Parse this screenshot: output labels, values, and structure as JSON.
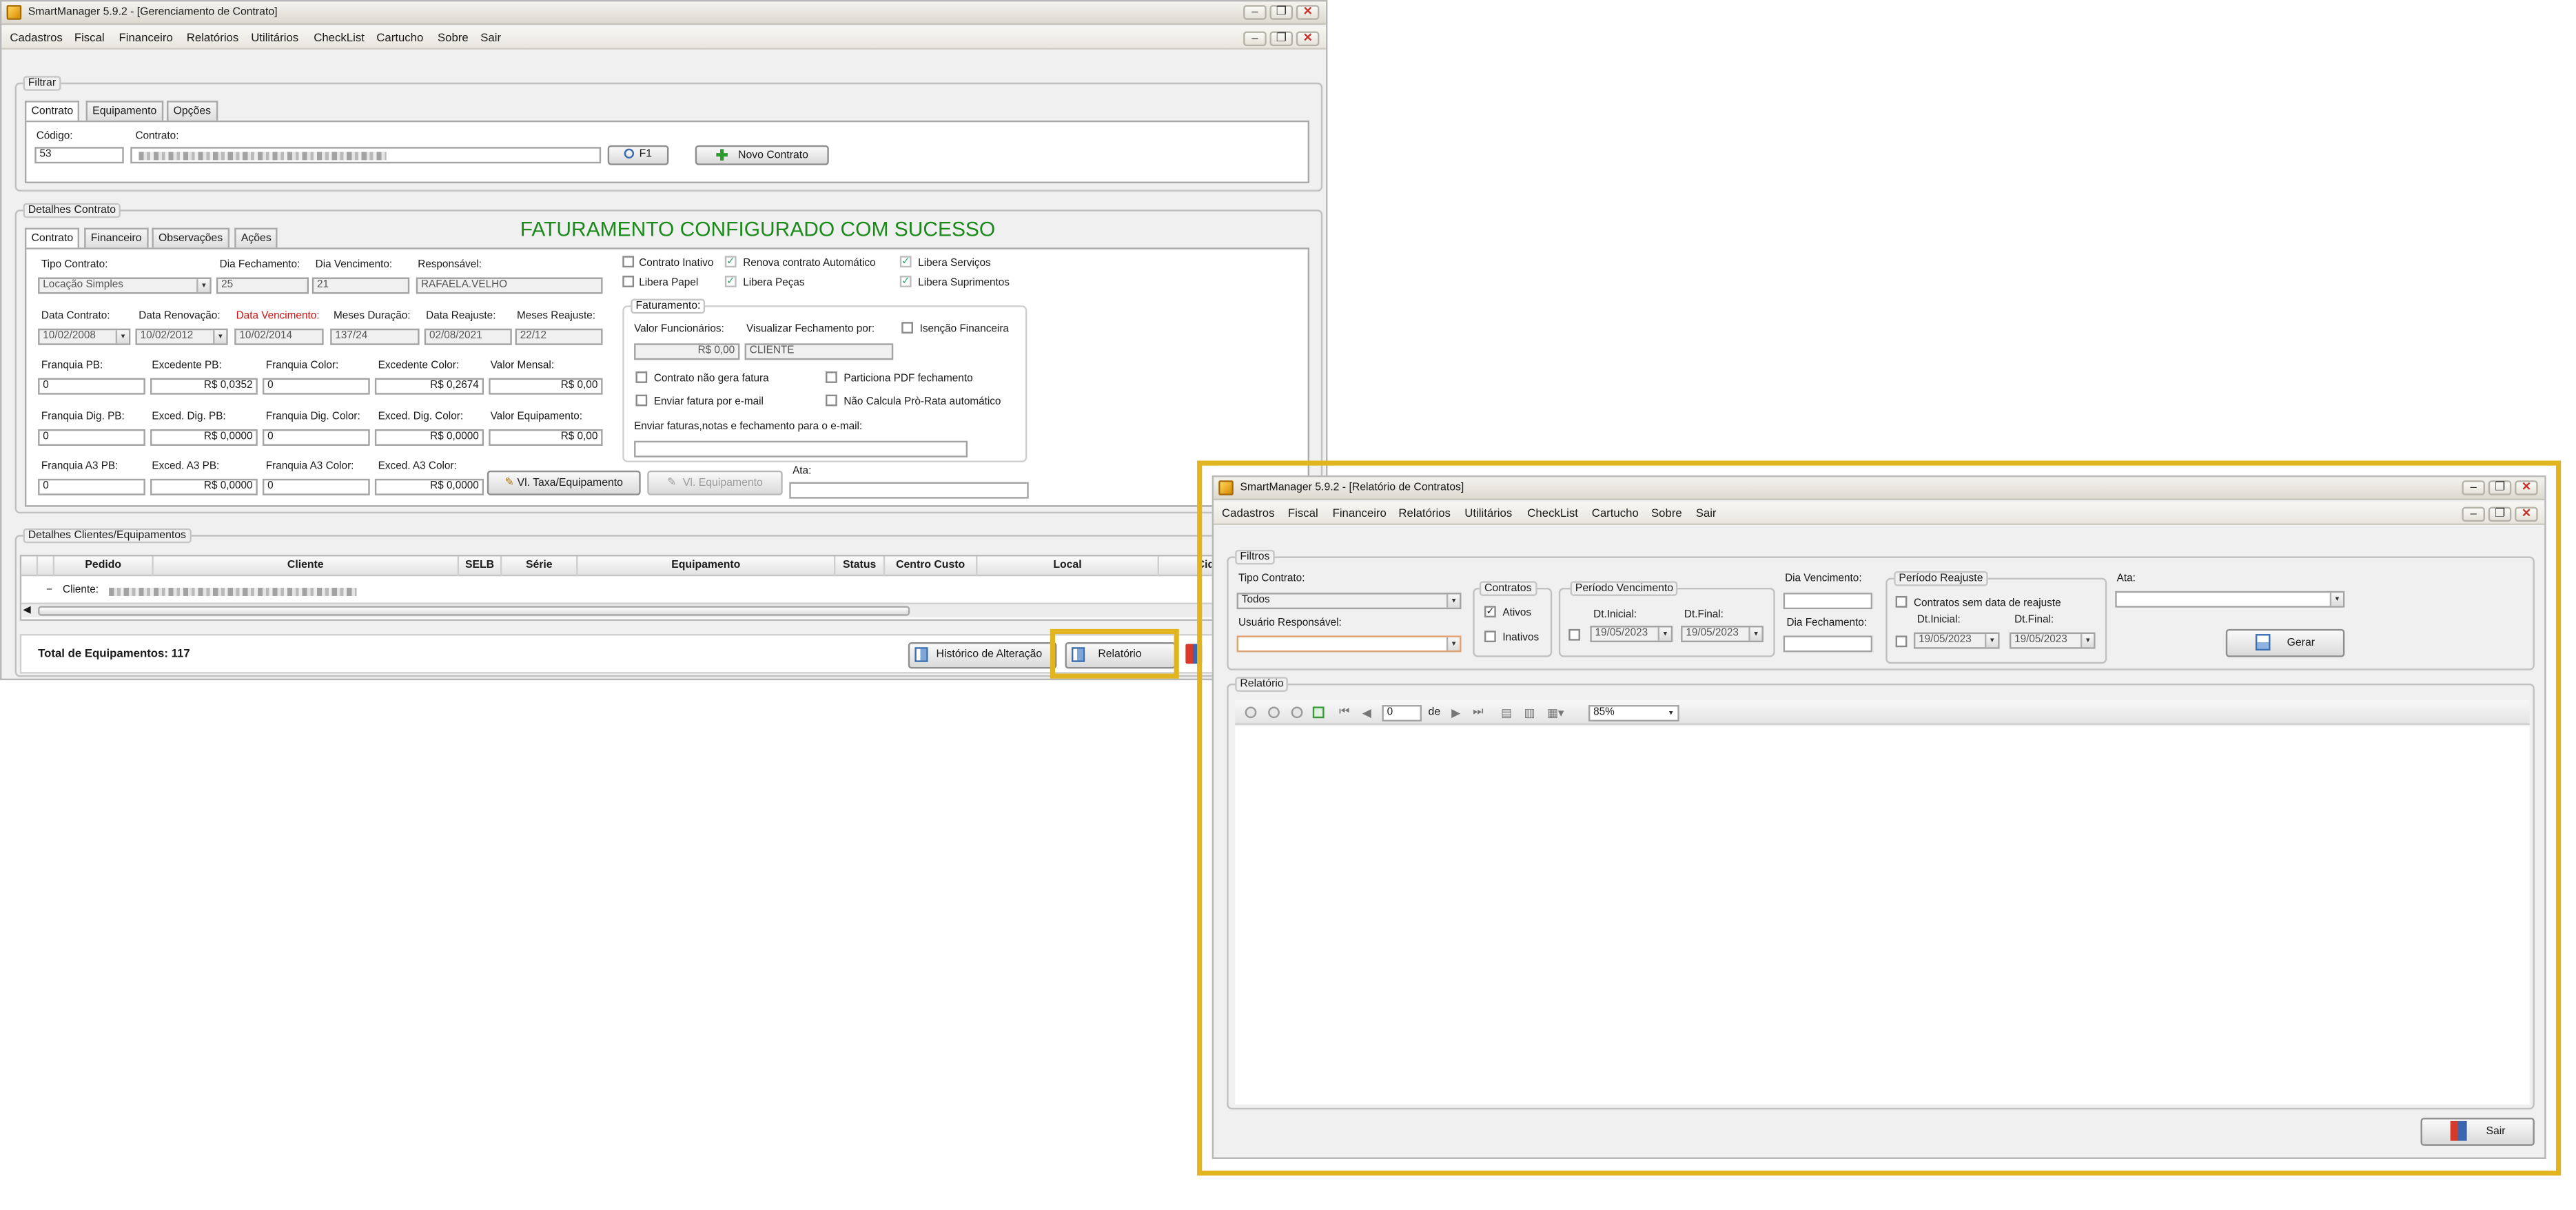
{
  "main": {
    "title": "SmartManager 5.9.2 - [Gerenciamento de Contrato]",
    "menu": [
      "Cadastros",
      "Fiscal",
      "Financeiro",
      "Relatórios",
      "Utilitários",
      "CheckList",
      "Cartucho",
      "Sobre",
      "Sair"
    ],
    "filtrar": {
      "legend": "Filtrar",
      "tabs": [
        "Contrato",
        "Equipamento",
        "Opções"
      ],
      "codigo_label": "Código:",
      "codigo_value": "53",
      "contrato_label": "Contrato:",
      "f1_label": "F1",
      "novo_contrato_label": "Novo Contrato"
    },
    "detalhes": {
      "legend": "Detalhes Contrato",
      "tabs": [
        "Contrato",
        "Financeiro",
        "Observações",
        "Ações"
      ],
      "success_message": "FATURAMENTO CONFIGURADO COM SUCESSO",
      "success_color": "#1a8a1a",
      "tipo_contrato_label": "Tipo Contrato:",
      "tipo_contrato_value": "Locação Simples",
      "dia_fechamento_label": "Dia Fechamento:",
      "dia_fechamento_value": "25",
      "dia_vencimento_label": "Dia Vencimento:",
      "dia_vencimento_value": "21",
      "responsavel_label": "Responsável:",
      "responsavel_value": "RAFAELA.VELHO",
      "data_contrato_label": "Data Contrato:",
      "data_contrato_value": "10/02/2008",
      "data_renovacao_label": "Data Renovação:",
      "data_renovacao_value": "10/02/2012",
      "data_vencimento_label": "Data Vencimento:",
      "data_vencimento_value": "10/02/2014",
      "meses_duracao_label": "Meses Duração:",
      "meses_duracao_value": "137/24",
      "data_reajuste_label": "Data Reajuste:",
      "data_reajuste_value": "02/08/2021",
      "meses_reajuste_label": "Meses Reajuste:",
      "meses_reajuste_value": "22/12",
      "franquia_pb_label": "Franquia PB:",
      "franquia_pb_value": "0",
      "excedente_pb_label": "Excedente PB:",
      "excedente_pb_value": "R$ 0,0352",
      "franquia_color_label": "Franquia Color:",
      "franquia_color_value": "0",
      "excedente_color_label": "Excedente Color:",
      "excedente_color_value": "R$ 0,2674",
      "valor_mensal_label": "Valor Mensal:",
      "valor_mensal_value": "R$ 0,00",
      "franquia_dig_pb_label": "Franquia Dig. PB:",
      "franquia_dig_pb_value": "0",
      "exced_dig_pb_label": "Exced. Dig. PB:",
      "exced_dig_pb_value": "R$ 0,0000",
      "franquia_dig_color_label": "Franquia Dig. Color:",
      "franquia_dig_color_value": "0",
      "exced_dig_color_label": "Exced. Dig. Color:",
      "exced_dig_color_value": "R$ 0,0000",
      "valor_equipamento_label": "Valor Equipamento:",
      "valor_equipamento_value": "R$ 0,00",
      "franquia_a3_pb_label": "Franquia A3 PB:",
      "franquia_a3_pb_value": "0",
      "exced_a3_pb_label": "Exced. A3 PB:",
      "exced_a3_pb_value": "R$ 0,0000",
      "franquia_a3_color_label": "Franquia A3 Color:",
      "franquia_a3_color_value": "0",
      "exced_a3_color_label": "Exced. A3 Color:",
      "exced_a3_color_value": "R$ 0,0000",
      "vl_taxa_button": "Vl. Taxa/Equipamento",
      "vl_equipamento_button": "Vl. Equipamento",
      "ata_label": "Ata:",
      "checks": {
        "contrato_inativo": "Contrato Inativo",
        "renova_automatico": "Renova contrato Automático",
        "libera_servicos": "Libera Serviços",
        "libera_papel": "Libera Papel",
        "libera_pecas": "Libera Peças",
        "libera_suprimentos": "Libera Suprimentos"
      },
      "faturamento": {
        "legend": "Faturamento:",
        "valor_funcionarios_label": "Valor Funcionários:",
        "valor_funcionarios_value": "R$ 0,00",
        "visualizar_label": "Visualizar Fechamento por:",
        "visualizar_value": "CLIENTE",
        "isencao_label": "Isenção Financeira",
        "nao_gera_fatura": "Contrato não gera fatura",
        "particiona_pdf": "Particiona PDF fechamento",
        "enviar_email": "Enviar fatura por e-mail",
        "nao_calcula": "Não Calcula Prò-Rata automático",
        "enviar_faturas_label": "Enviar faturas,notas e fechamento para o e-mail:"
      }
    },
    "clientes": {
      "legend": "Detalhes Clientes/Equipamentos",
      "columns": [
        "Pedido",
        "Cliente",
        "SELB",
        "Série",
        "Equipamento",
        "Status",
        "Centro Custo",
        "Local",
        "Cida"
      ],
      "row_prefix": "Cliente:",
      "total_label": "Total de Equipamentos: 117",
      "historico_button": "Histórico de Alteração",
      "relatorio_button": "Relatório"
    }
  },
  "report": {
    "title": "SmartManager 5.9.2 - [Relatório de Contratos]",
    "menu": [
      "Cadastros",
      "Fiscal",
      "Financeiro",
      "Relatórios",
      "Utilitários",
      "CheckList",
      "Cartucho",
      "Sobre",
      "Sair"
    ],
    "filtros_legend": "Filtros",
    "tipo_contrato_label": "Tipo Contrato:",
    "tipo_contrato_value": "Todos",
    "usuario_label": "Usuário Responsável:",
    "contratos_legend": "Contratos",
    "ativos_label": "Ativos",
    "ativos_checked": true,
    "inativos_label": "Inativos",
    "periodo_venc_legend": "Período Vencimento",
    "dt_inicial_label": "Dt.Inicial:",
    "dt_inicial_value": "19/05/2023",
    "dt_final_label": "Dt.Final:",
    "dt_final_value": "19/05/2023",
    "dia_vencimento_label": "Dia Vencimento:",
    "dia_fechamento_label": "Dia Fechamento:",
    "periodo_reajuste_legend": "Período Reajuste",
    "sem_reajuste_label": "Contratos sem data de reajuste",
    "reaj_dt_inicial_label": "Dt.Inicial:",
    "reaj_dt_inicial_value": "19/05/2023",
    "reaj_dt_final_label": "Dt.Final:",
    "reaj_dt_final_value": "19/05/2023",
    "ata_label": "Ata:",
    "gerar_button": "Gerar",
    "relatorio_legend": "Relatório",
    "page_value": "0",
    "page_of_label": "de",
    "zoom_value": "85%",
    "sair_button": "Sair"
  },
  "highlight_color": "#e2b520"
}
